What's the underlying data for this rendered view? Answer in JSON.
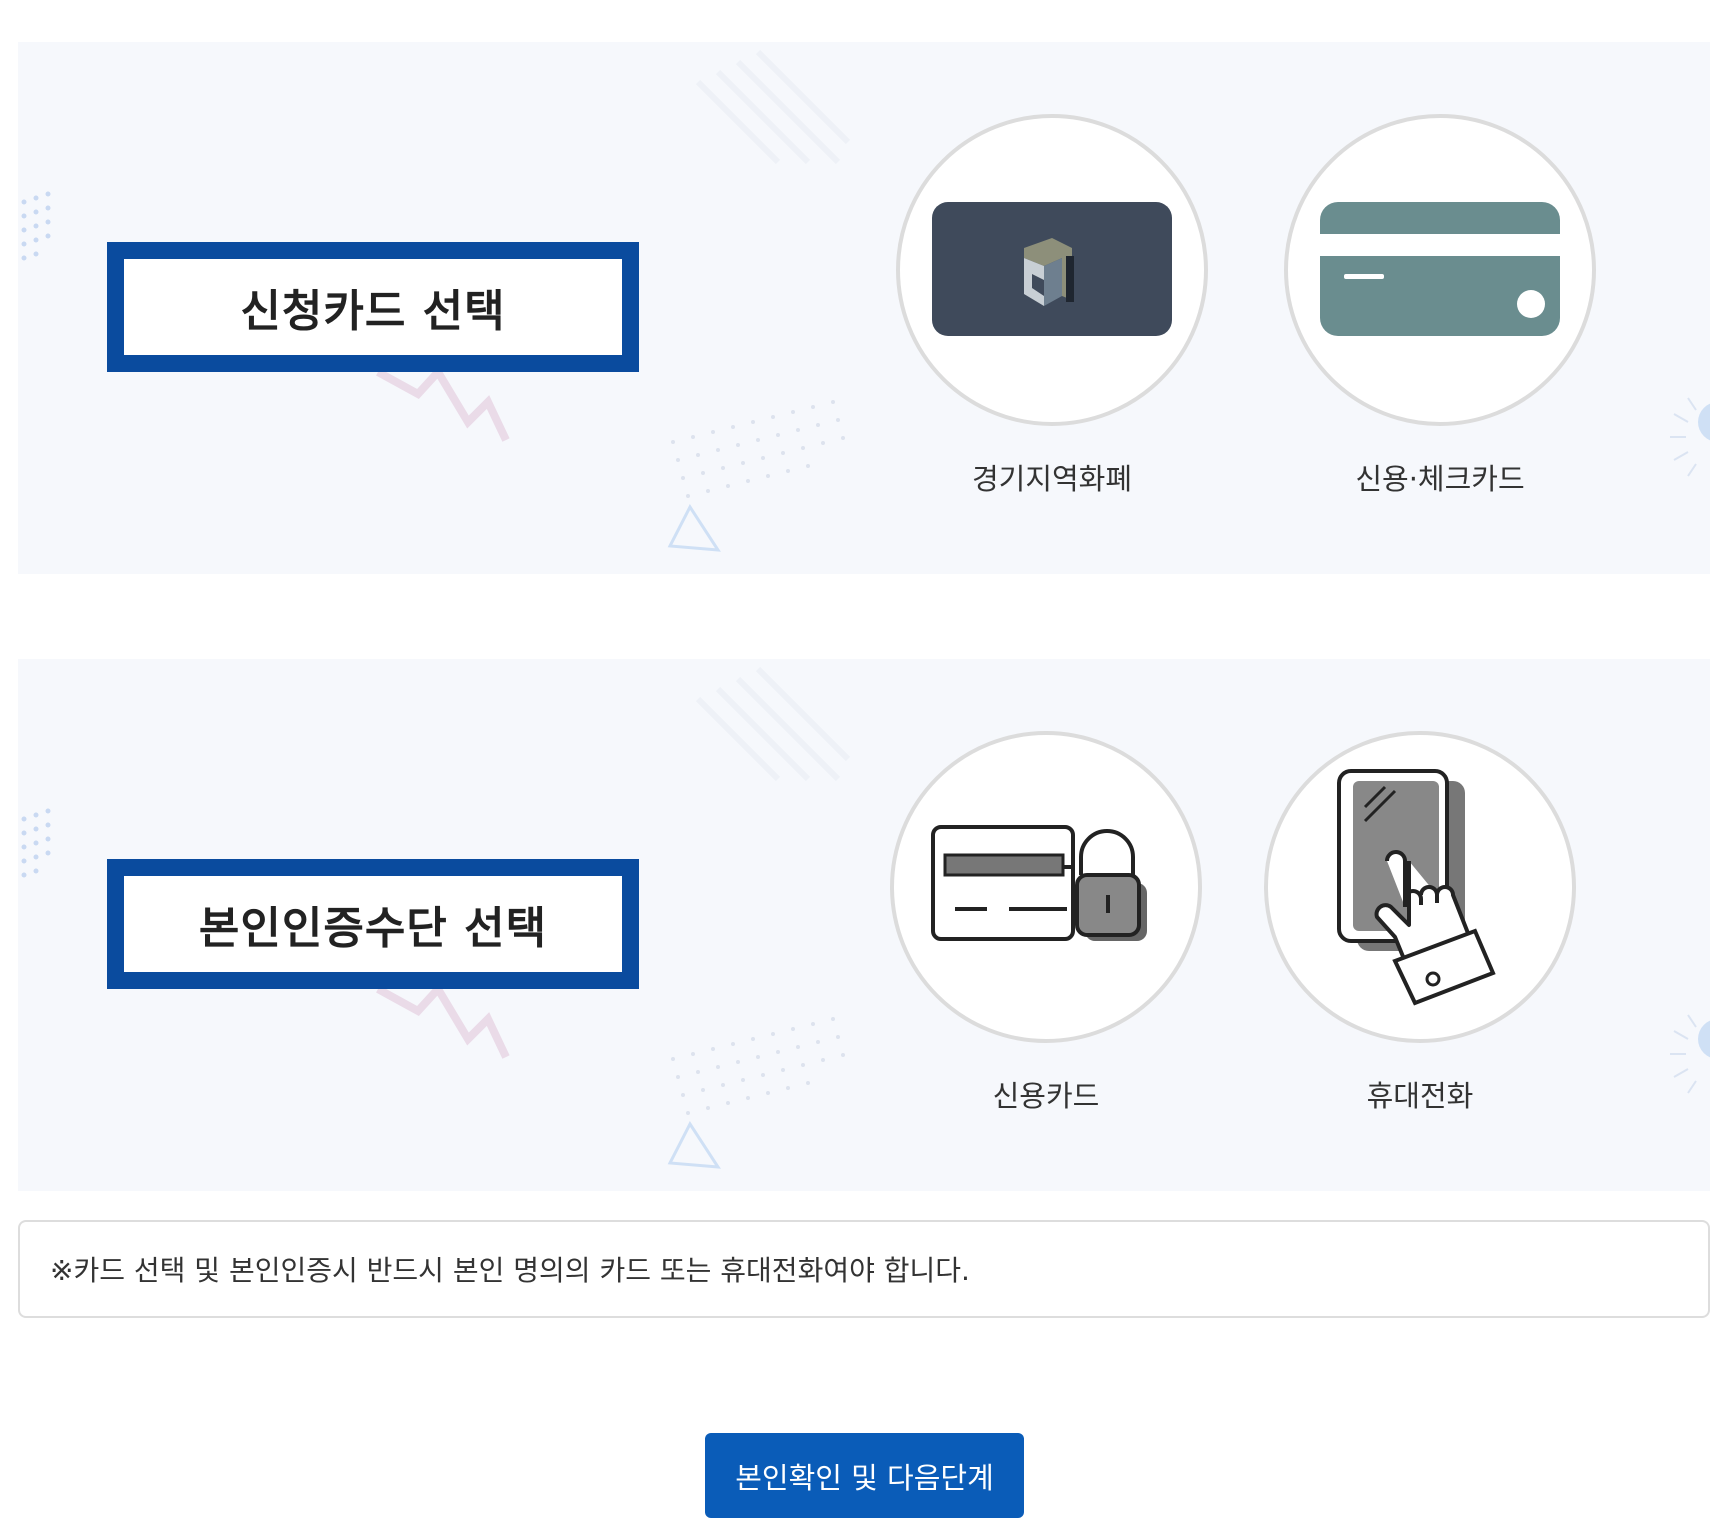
{
  "card_section": {
    "title": "신청카드 선택",
    "options": [
      {
        "label": "경기지역화폐",
        "icon": "local-currency-card-icon"
      },
      {
        "label": "신용·체크카드",
        "icon": "credit-check-card-icon"
      }
    ]
  },
  "auth_section": {
    "title": "본인인증수단 선택",
    "options": [
      {
        "label": "신용카드",
        "icon": "card-lock-icon"
      },
      {
        "label": "휴대전화",
        "icon": "phone-touch-icon"
      }
    ]
  },
  "notice": {
    "text": "※카드 선택 및 본인인증시 반드시 본인 명의의 카드 또는 휴대전화여야 합니다."
  },
  "next_button": {
    "label": "본인확인 및 다음단계"
  },
  "colors": {
    "title_border": "#0a4b9e",
    "button": "#0a5cb8",
    "panel_bg": "#f6f8fc",
    "local_card": "#3f4a5b",
    "credit_card": "#6a8d8f"
  }
}
